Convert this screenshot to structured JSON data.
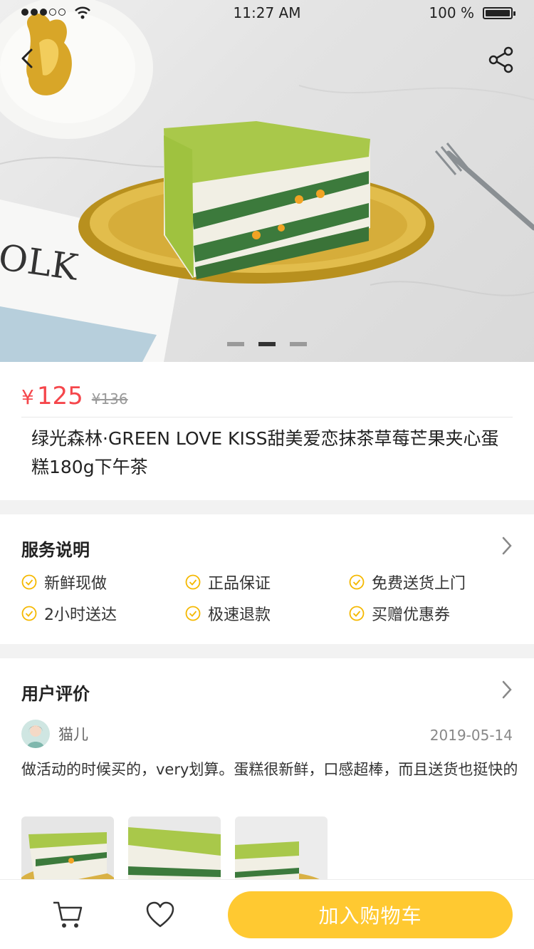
{
  "status_bar": {
    "time": "11:27 AM",
    "battery": "100 %"
  },
  "hero": {
    "slide_count": 3,
    "active_slide": 2
  },
  "product": {
    "currency": "¥",
    "price": "125",
    "original_price": "¥136",
    "title": "绿光森林·GREEN LOVE KISS甜美爱恋抹茶草莓芒果夹心蛋糕180g下午茶"
  },
  "services": {
    "title": "服务说明",
    "items": [
      "新鲜现做",
      "正品保证",
      "免费送货上门",
      "2小时送达",
      "极速退款",
      "买赠优惠券"
    ]
  },
  "reviews": {
    "title": "用户评价",
    "reviewer": "猫儿",
    "date": "2019-05-14",
    "text": "做活动的时候买的，very划算。蛋糕很新鲜，口感超棒，而且送货也挺快的"
  },
  "bottom_bar": {
    "add_to_cart_label": "加入购物车"
  },
  "colors": {
    "price": "#f5464b",
    "accent": "#ffc931",
    "check": "#f5b800"
  }
}
